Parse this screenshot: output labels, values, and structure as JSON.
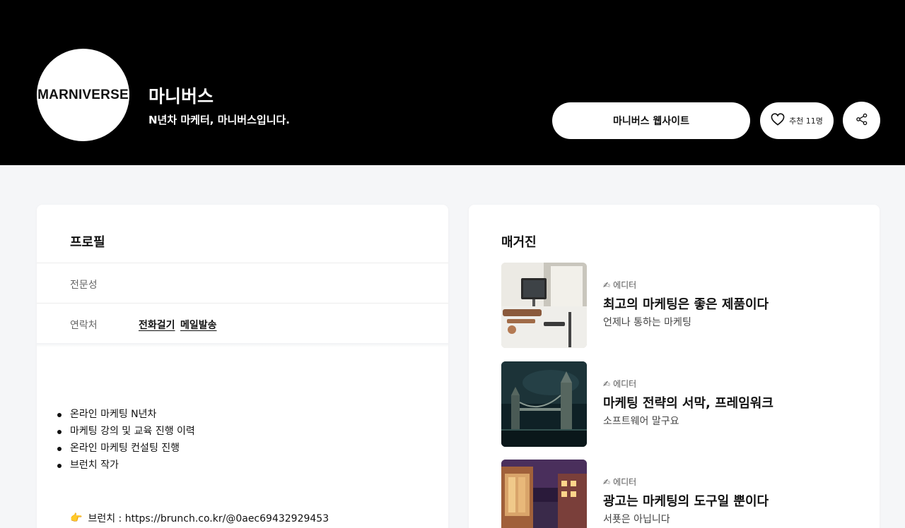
{
  "header": {
    "logo_text": "MARNIVERSE",
    "name": "마니버스",
    "tagline": "N년차 마케터, 마니버스입니다.",
    "website_button": "마니버스 웹사이트",
    "like_label": "추천 11명",
    "like_icon": "heart-icon",
    "share_icon": "share-icon"
  },
  "profile": {
    "title": "프로필",
    "expertise_label": "전문성",
    "contact_label": "연락처",
    "contact_links": [
      "전화걸기",
      "메일발송"
    ],
    "bullets": [
      "온라인 마케팅 N년차",
      "마케팅 강의 및 교육 진행 이력",
      "온라인 마케팅 컨설팅 진행",
      "브런치 작가"
    ],
    "brunch_emoji": "👉",
    "brunch_text": "브런치 : https://brunch.co.kr/@0aec69432929453"
  },
  "magazine": {
    "title": "매거진",
    "items": [
      {
        "role_emoji": "✍",
        "role": "에디터",
        "title": "최고의 마케팅은 좋은 제품이다",
        "subtitle": "언제나 통하는 마케팅"
      },
      {
        "role_emoji": "✍",
        "role": "에디터",
        "title": "마케팅 전략의 서막, 프레임워크",
        "subtitle": "소프트웨어 말구요"
      },
      {
        "role_emoji": "✍",
        "role": "에디터",
        "title": "광고는 마케팅의 도구일 뿐이다",
        "subtitle": "서푯은 아닙니다"
      }
    ]
  },
  "colors": {
    "hero_bg": "#000000",
    "page_bg": "#f5f6f8",
    "card_bg": "#ffffff"
  }
}
